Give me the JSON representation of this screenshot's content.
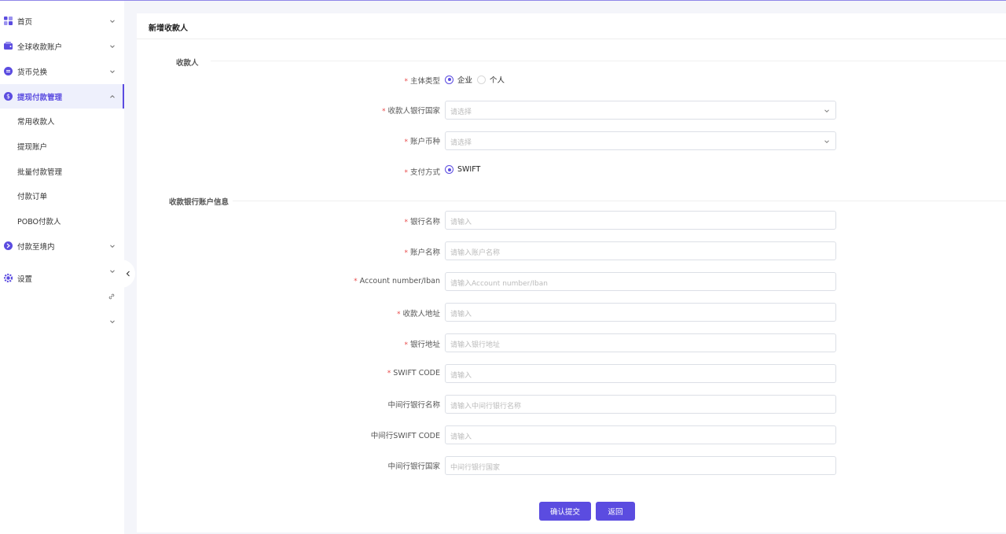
{
  "sidebar": {
    "items": [
      {
        "label": "首页",
        "icon": "dashboard-icon"
      },
      {
        "label": "全球收款账户",
        "icon": "wallet-icon"
      },
      {
        "label": "货币兑换",
        "icon": "exchange-icon"
      },
      {
        "label": "提现付款管理",
        "icon": "dollar-icon",
        "active": true,
        "children": [
          "常用收款人",
          "提现账户",
          "批量付款管理",
          "付款订单",
          "POBO付款人"
        ]
      },
      {
        "label": "付款至境内",
        "icon": "transfer-icon"
      },
      {
        "label": "设置",
        "icon": "gear-icon"
      }
    ]
  },
  "page": {
    "title": "新增收款人"
  },
  "sections": {
    "payee": "收款人",
    "bank": "收款银行账户信息"
  },
  "form": {
    "entity_type": {
      "label": "主体类型",
      "required": true,
      "options": [
        "企业",
        "个人"
      ],
      "selected": "企业"
    },
    "bank_country": {
      "label": "收款人银行国家",
      "required": true,
      "placeholder": "请选择"
    },
    "currency": {
      "label": "账户币种",
      "required": true,
      "placeholder": "请选择"
    },
    "payment_method": {
      "label": "支付方式",
      "required": true,
      "options": [
        "SWIFT"
      ],
      "selected": "SWIFT"
    },
    "bank_name": {
      "label": "银行名称",
      "required": true,
      "placeholder": "请输入"
    },
    "account_name": {
      "label": "账户名称",
      "required": true,
      "placeholder": "请输入账户名称"
    },
    "account_number": {
      "label": "Account number/Iban",
      "required": true,
      "placeholder": "请输入Account number/Iban"
    },
    "payee_address": {
      "label": "收款人地址",
      "required": true,
      "placeholder": "请输入"
    },
    "bank_address": {
      "label": "银行地址",
      "required": true,
      "placeholder": "请输入银行地址"
    },
    "swift_code": {
      "label": "SWIFT CODE",
      "required": true,
      "placeholder": "请输入"
    },
    "intermediary_bank_name": {
      "label": "中间行银行名称",
      "required": false,
      "placeholder": "请输入中间行银行名称"
    },
    "intermediary_swift": {
      "label": "中间行SWIFT CODE",
      "required": false,
      "placeholder": "请输入"
    },
    "intermediary_country": {
      "label": "中间行银行国家",
      "required": false,
      "placeholder": "中间行银行国家"
    }
  },
  "buttons": {
    "submit": "确认提交",
    "back": "返回"
  },
  "colors": {
    "accent": "#5b4ce0",
    "required": "#e84a4a",
    "border": "#dcdfe6"
  }
}
